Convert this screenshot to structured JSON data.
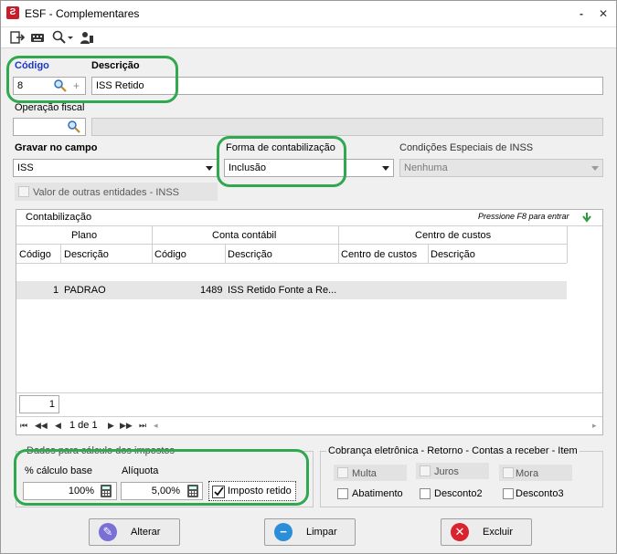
{
  "window": {
    "title": "ESF - Complementares",
    "minimize_label": "-",
    "close_label": "✕"
  },
  "form": {
    "codigo_label": "Código",
    "codigo_value": "8",
    "codigo_plus": "+",
    "descricao_label": "Descrição",
    "descricao_value": "ISS Retido",
    "operacao_label": "Operação fiscal",
    "operacao_value": "",
    "operacao_desc": "",
    "gravar_label": "Gravar no campo",
    "gravar_value": "ISS",
    "forma_label": "Forma de contabilização",
    "forma_value": "Inclusão",
    "condicoes_label": "Condições Especiais de INSS",
    "condicoes_value": "Nenhuma",
    "valor_outras_label": "Valor de outras entidades - INSS"
  },
  "contabilizacao": {
    "title": "Contabilização",
    "hint": "Pressione F8 para entrar",
    "groups": [
      "Plano",
      "Conta contábil",
      "Centro de custos"
    ],
    "columns": [
      "Código",
      "Descrição",
      "Código",
      "Descrição",
      "Centro de custos",
      "Descrição"
    ],
    "rows": [
      {
        "plano_codigo": "1",
        "plano_descricao": "PADRAO",
        "conta_codigo": "1489",
        "conta_descricao": "ISS Retido Fonte a Re..."
      }
    ],
    "page_input": "1",
    "page_info": "1 de 1"
  },
  "impostos": {
    "group_title": "Dados para cálculo dos impostos",
    "calculo_label": "% cálculo base",
    "calculo_value": "100%",
    "aliquota_label": "Alíquota",
    "aliquota_value": "5,00%",
    "imposto_retido_label": "Imposto retido",
    "imposto_retido_checked": true
  },
  "cobranca": {
    "group_title": "Cobrança eletrônica - Retorno - Contas a receber - Item",
    "items": [
      "Multa",
      "Juros",
      "Mora",
      "Abatimento",
      "Desconto2",
      "Desconto3"
    ]
  },
  "buttons": {
    "alterar": "Alterar",
    "limpar": "Limpar",
    "excluir": "Excluir"
  },
  "colors": {
    "accent_outline": "#2fa84f",
    "alterar_icon": "#7a6fd6",
    "limpar_icon": "#2a8fd8",
    "excluir_icon": "#d9232e",
    "codigo_label": "#1a37c9"
  }
}
